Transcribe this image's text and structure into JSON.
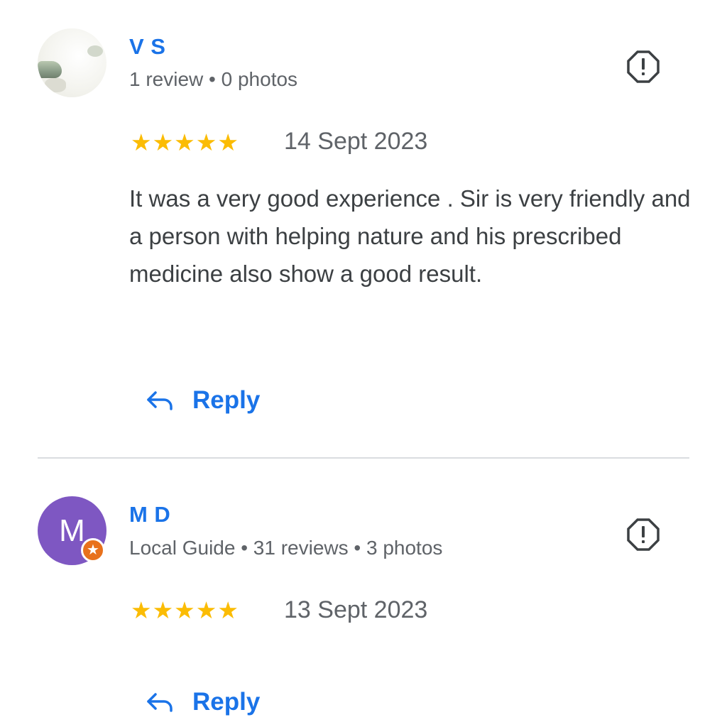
{
  "reviews": [
    {
      "name": "V        S",
      "meta": "1 review • 0 photos",
      "rating": "★★★★★",
      "date": "14 Sept 2023",
      "text": "It was a very good experience . Sir is very friendly and a person with helping nature and his prescribed medicine also show a good result.",
      "reply_label": "Reply",
      "avatar": "photo"
    },
    {
      "name": "M            D",
      "avatar_letter": "M",
      "meta": "Local Guide • 31 reviews • 3 photos",
      "rating": "★★★★★",
      "date": "13 Sept 2023",
      "reply_label": "Reply",
      "avatar": "letter",
      "badge": "local-guide-star"
    }
  ],
  "icons": {
    "report": "report-octagon-icon",
    "reply": "reply-arrow-icon",
    "star": "star-icon"
  },
  "colors": {
    "name": "#1a73e8",
    "stars": "#fbbc04",
    "avatar_bg": "#7e57c2",
    "badge": "#e8711c"
  }
}
